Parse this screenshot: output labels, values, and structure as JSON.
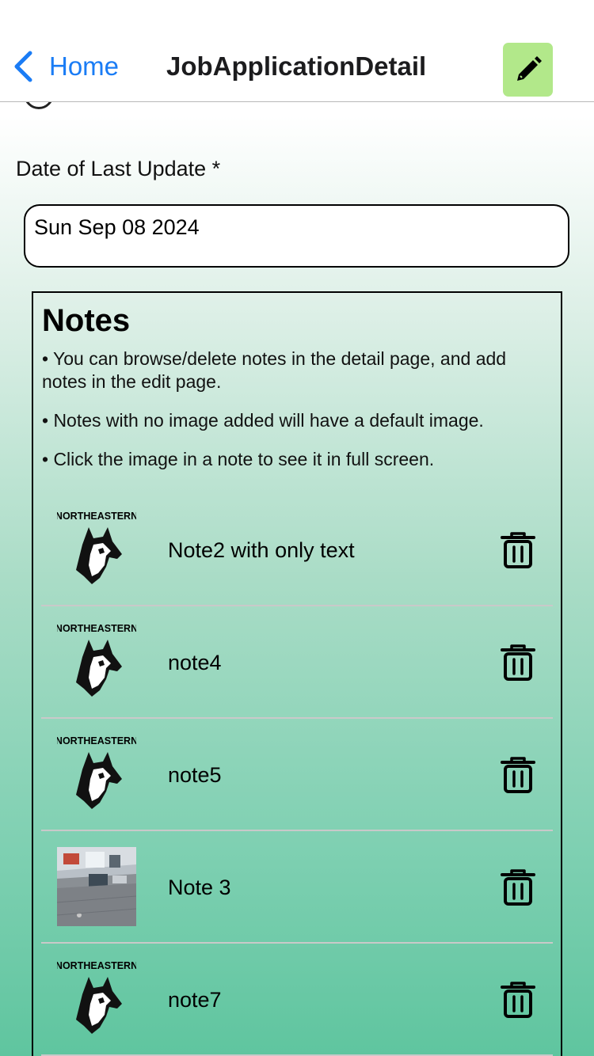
{
  "nav": {
    "back_label": "Home",
    "title": "JobApplicationDetail",
    "edit_icon": "pencil-icon"
  },
  "form": {
    "date_label": "Date of Last Update *",
    "date_value": "Sun Sep 08 2024"
  },
  "notes": {
    "heading": "Notes",
    "tips": [
      "• You can browse/delete notes in the detail page, and add notes in the edit page.",
      "• Notes with no image added will have a default image.",
      "• Click the image in a note to see it in full screen."
    ],
    "logo_text": "NORTHEASTERN",
    "items": [
      {
        "text": "Note2 with only text",
        "image": "northeastern-husky-logo"
      },
      {
        "text": "note4",
        "image": "northeastern-husky-logo"
      },
      {
        "text": "note5",
        "image": "northeastern-husky-logo"
      },
      {
        "text": "Note 3",
        "image": "office-photo"
      },
      {
        "text": "note7",
        "image": "northeastern-husky-logo"
      }
    ]
  },
  "colors": {
    "accent": "#1a7cf5",
    "edit_button": "#b2e88a",
    "gradient_bottom": "#5fc59f"
  }
}
